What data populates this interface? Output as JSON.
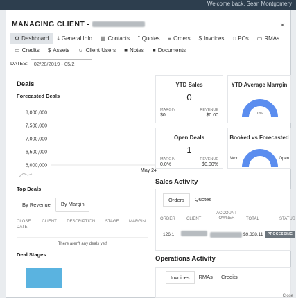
{
  "topbar": {
    "welcome": "Welcome back, Sean Montgomery"
  },
  "modal": {
    "title": "MANAGING CLIENT - ",
    "close": "×"
  },
  "tabs": [
    {
      "label": "Dashboard",
      "icon": "dashboard-icon",
      "glyph": "⚙"
    },
    {
      "label": "General Info",
      "icon": "info-icon",
      "glyph": "⤓"
    },
    {
      "label": "Contacts",
      "icon": "contacts-icon",
      "glyph": "▤"
    },
    {
      "label": "Quotes",
      "icon": "quotes-icon",
      "glyph": "”"
    },
    {
      "label": "Orders",
      "icon": "orders-icon",
      "glyph": "≡"
    },
    {
      "label": "Invoices",
      "icon": "invoices-icon",
      "glyph": "$"
    },
    {
      "label": "POs",
      "icon": "pos-icon",
      "glyph": "◌"
    },
    {
      "label": "RMAs",
      "icon": "rmas-icon",
      "glyph": "▭"
    },
    {
      "label": "Credits",
      "icon": "credits-icon",
      "glyph": "▭"
    },
    {
      "label": "Assets",
      "icon": "assets-icon",
      "glyph": "$"
    },
    {
      "label": "Client Users",
      "icon": "users-icon",
      "glyph": "☺"
    },
    {
      "label": "Notes",
      "icon": "notes-icon",
      "glyph": "■"
    },
    {
      "label": "Documents",
      "icon": "documents-icon",
      "glyph": "■"
    }
  ],
  "dates": {
    "label": "DATES:",
    "value": "02/28/2019 - 05/2"
  },
  "deals": {
    "title": "Deals",
    "subtitle": "Forecasted Deals",
    "top_deals": "Top Deals",
    "tab_revenue": "By Revenue",
    "tab_margin": "By Margin",
    "columns": [
      "CLOSE DATE",
      "CLIENT",
      "DESCRIPTION",
      "STAGE",
      "MARGIN"
    ],
    "empty": "There aren't any deals yet!",
    "stages_title": "Deal Stages"
  },
  "chart_data": {
    "type": "line",
    "title": "Forecasted Deals",
    "x": [
      "May 24"
    ],
    "yticks": [
      6000000,
      6500000,
      7000000,
      7500000,
      8000000
    ],
    "ytick_labels": [
      "6,000,000",
      "6,500,000",
      "7,000,000",
      "7,500,000",
      "8,000,000"
    ],
    "ylim": [
      6000000,
      8000000
    ],
    "series": [],
    "xlabel": "",
    "ylabel": ""
  },
  "cards": {
    "ytd_sales": {
      "title": "YTD Sales",
      "value": "0",
      "margin_label": "MARGIN",
      "margin_value": "$0",
      "revenue_label": "REVENUE",
      "revenue_value": "$0.00"
    },
    "ytd_avg_margin": {
      "title": "YTD Average Marrgin",
      "gauge_label": "0%"
    },
    "open_deals": {
      "title": "Open Deals",
      "value": "1",
      "margin_label": "MARGIN",
      "margin_value": "0.0%",
      "revenue_label": "REVENUE",
      "revenue_value": "$0.00%"
    },
    "booked_vs_forecasted": {
      "title": "Booked vs Forecasted",
      "won": "Won",
      "open": "Open"
    }
  },
  "sales_activity": {
    "title": "Sales Activity",
    "tabs": [
      "Orders",
      "Quotes"
    ],
    "columns": [
      "ORDER",
      "CLIENT",
      "ACCOUNT OWNER",
      "TOTAL",
      "STATUS"
    ],
    "row": {
      "order": "126.1",
      "total": "$9,338.11",
      "status": "PROCESSING"
    }
  },
  "operations_activity": {
    "title": "Operations Activity",
    "tabs": [
      "Invoices",
      "RMAs",
      "Credits"
    ]
  },
  "footer": {
    "close": "Close"
  },
  "colors": {
    "accent": "#5ab3e0",
    "gauge": "#5b8def",
    "topbar": "#2d3e4e",
    "badge": "#6c757d"
  }
}
